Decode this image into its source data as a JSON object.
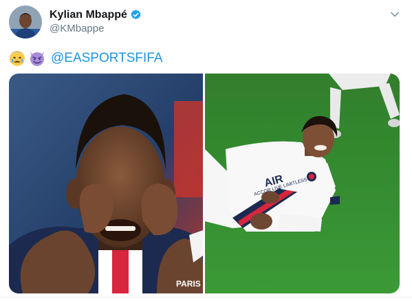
{
  "user": {
    "display_name": "Kylian Mbappé",
    "handle": "@KMbappe",
    "verified": true,
    "avatar_icon": "avatar-photo"
  },
  "tweet": {
    "emojis": [
      "crying-face-emoji",
      "smiling-face-with-horns-emoji"
    ],
    "mention": "@EASPORTSFIFA",
    "mention_color": "#1b95e0"
  },
  "media": {
    "photos": [
      {
        "icon": "photo-celebration",
        "shirt_text": "PARIS"
      },
      {
        "icon": "photo-on-pitch",
        "shirt_text": "AIR",
        "sponsor_text": "ACCOR LIVE LIMITLESS"
      }
    ]
  },
  "colors": {
    "text_primary": "#14171a",
    "text_secondary": "#657786",
    "verified_badge": "#1da1f2",
    "psg_navy": "#1c2a4f",
    "psg_red": "#d7263d",
    "pitch_green": "#2e8a2c"
  }
}
